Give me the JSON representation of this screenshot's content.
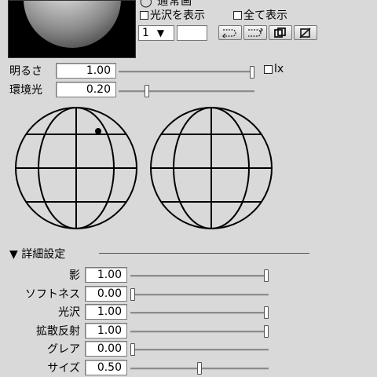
{
  "header": {
    "cropped_label": "◯ 通常画",
    "show_gloss_label": "光沢を表示",
    "show_all_label": "全て表示",
    "select_value": "1",
    "select_arrow": "▼",
    "buttons": [
      "⊃",
      "⊃",
      "⧉",
      "∅"
    ]
  },
  "lighting": {
    "brightness": {
      "label": "明るさ",
      "value": "1.00",
      "level": 1.0
    },
    "ambient": {
      "label": "環境光",
      "value": "0.20",
      "level": 0.2
    },
    "lx_label": "lx"
  },
  "light_dot": {
    "present": true
  },
  "details": {
    "title": "▼ 詳細設定",
    "rows": [
      {
        "label": "影",
        "value": "1.00",
        "level": 1.0
      },
      {
        "label": "ソフトネス",
        "value": "0.00",
        "level": 0.0
      },
      {
        "label": "光沢",
        "value": "1.00",
        "level": 1.0
      },
      {
        "label": "拡散反射",
        "value": "1.00",
        "level": 1.0
      },
      {
        "label": "グレア",
        "value": "0.00",
        "level": 0.0
      },
      {
        "label": "サイズ",
        "value": "0.50",
        "level": 0.5
      }
    ]
  }
}
